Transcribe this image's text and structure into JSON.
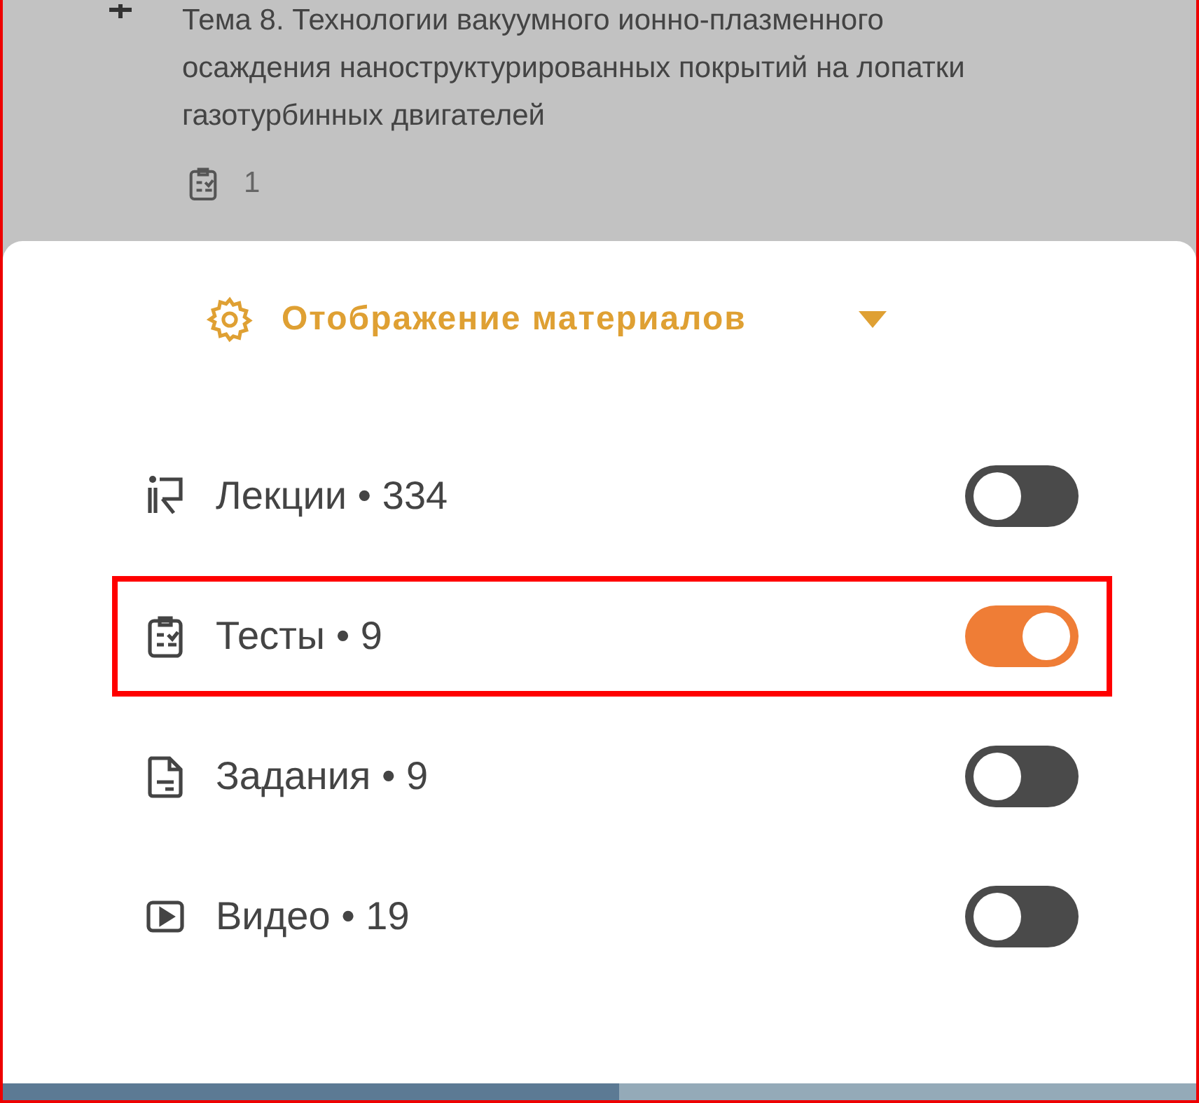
{
  "topic": {
    "title": "Тема 8. Технологии вакуумного ионно-плазменного осаждения наноструктурированных покрытий на лопатки газотурбинных двигателей",
    "tests_count": "1"
  },
  "sheet": {
    "title": "Отображение материалов",
    "expanded": true,
    "items": [
      {
        "kind": "lectures",
        "label": "Лекции • 334",
        "on": false,
        "highlighted": false
      },
      {
        "kind": "tests",
        "label": "Тесты • 9",
        "on": true,
        "highlighted": true
      },
      {
        "kind": "tasks",
        "label": "Задания • 9",
        "on": false,
        "highlighted": false
      },
      {
        "kind": "video",
        "label": "Видео • 19",
        "on": false,
        "highlighted": false
      }
    ]
  }
}
